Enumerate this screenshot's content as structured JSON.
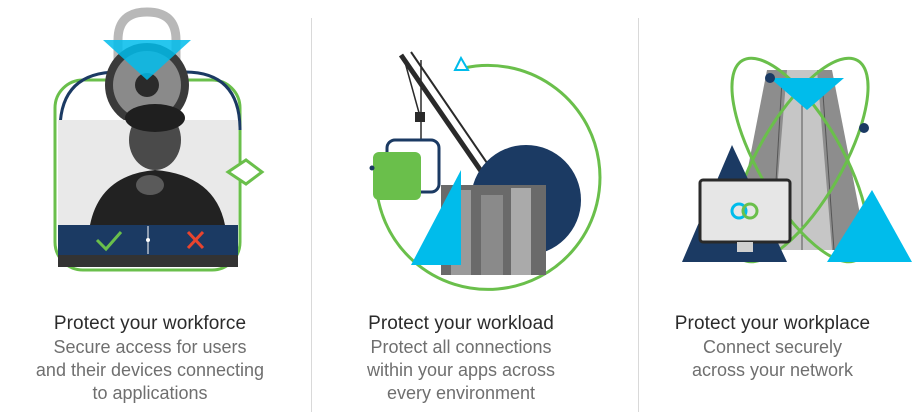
{
  "cards": [
    {
      "title": "Protect your workforce",
      "description_lines": [
        "Secure access for users",
        "and their devices connecting",
        "to applications"
      ]
    },
    {
      "title": "Protect your workload",
      "description_lines": [
        "Protect all connections",
        "within your apps across",
        "every environment"
      ]
    },
    {
      "title": "Protect your workplace",
      "description_lines": [
        "Connect securely",
        "across your network"
      ]
    }
  ],
  "colors": {
    "green": "#6abf4b",
    "navy": "#1b3a63",
    "cyan": "#00bceb",
    "title": "#2b2b2b",
    "desc": "#6f6f6f",
    "divider": "#d9d9d9"
  },
  "icons": [
    "lock-icon",
    "check-icon",
    "x-icon",
    "crane-icon",
    "building-icon",
    "monitor-icon",
    "link-icon"
  ]
}
